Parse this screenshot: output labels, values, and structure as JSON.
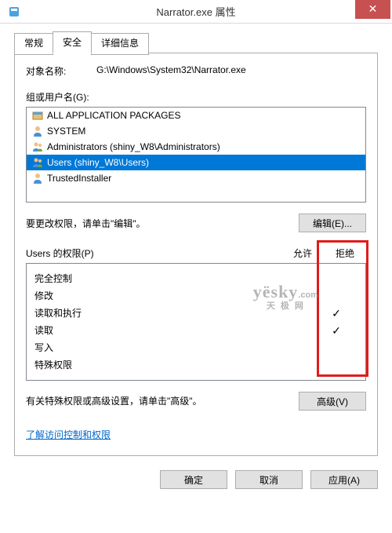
{
  "window": {
    "title": "Narrator.exe 属性",
    "close": "✕"
  },
  "tabs": {
    "general": "常规",
    "security": "安全",
    "details": "详细信息"
  },
  "object": {
    "label": "对象名称:",
    "path": "G:\\Windows\\System32\\Narrator.exe"
  },
  "groups": {
    "label": "组或用户名(G):",
    "items": [
      {
        "name": "ALL APPLICATION PACKAGES",
        "icon": "package",
        "selected": false
      },
      {
        "name": "SYSTEM",
        "icon": "user",
        "selected": false
      },
      {
        "name": "Administrators (shiny_W8\\Administrators)",
        "icon": "users",
        "selected": false
      },
      {
        "name": "Users (shiny_W8\\Users)",
        "icon": "users",
        "selected": true
      },
      {
        "name": "TrustedInstaller",
        "icon": "user",
        "selected": false
      }
    ]
  },
  "edit": {
    "hint": "要更改权限，请单击\"编辑\"。",
    "button": "编辑(E)..."
  },
  "perm": {
    "header_name": "Users 的权限(P)",
    "header_allow": "允许",
    "header_deny": "拒绝",
    "rows": [
      {
        "name": "完全控制",
        "allow": "",
        "deny": ""
      },
      {
        "name": "修改",
        "allow": "",
        "deny": ""
      },
      {
        "name": "读取和执行",
        "allow": "",
        "deny": "✓"
      },
      {
        "name": "读取",
        "allow": "",
        "deny": "✓"
      },
      {
        "name": "写入",
        "allow": "",
        "deny": ""
      },
      {
        "name": "特殊权限",
        "allow": "",
        "deny": ""
      }
    ]
  },
  "advanced": {
    "hint": "有关特殊权限或高级设置，请单击\"高级\"。",
    "button": "高级(V)"
  },
  "link": "了解访问控制和权限",
  "footer": {
    "ok": "确定",
    "cancel": "取消",
    "apply": "应用(A)"
  },
  "watermark": {
    "line1": "yësky",
    "line2": "天 极 网",
    "suffix": ".com"
  }
}
